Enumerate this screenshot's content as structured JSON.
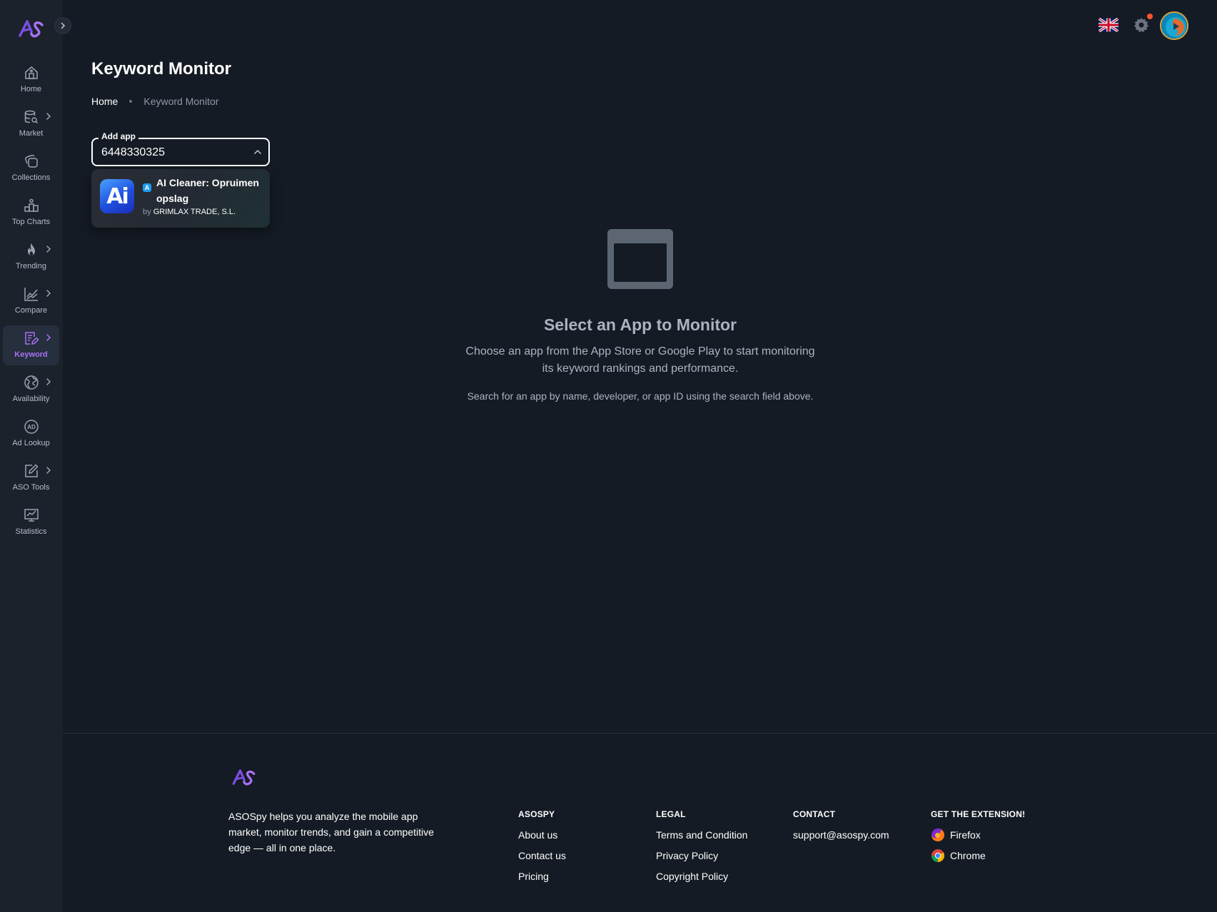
{
  "sidebar": {
    "items": [
      {
        "label": "Home",
        "icon": "home-icon",
        "has_submenu": false,
        "active": false
      },
      {
        "label": "Market",
        "icon": "database-search-icon",
        "has_submenu": true,
        "active": false
      },
      {
        "label": "Collections",
        "icon": "collections-icon",
        "has_submenu": false,
        "active": false
      },
      {
        "label": "Top Charts",
        "icon": "podium-icon",
        "has_submenu": false,
        "active": false
      },
      {
        "label": "Trending",
        "icon": "flame-icon",
        "has_submenu": true,
        "active": false
      },
      {
        "label": "Compare",
        "icon": "line-chart-icon",
        "has_submenu": true,
        "active": false
      },
      {
        "label": "Keyword",
        "icon": "keyword-edit-icon",
        "has_submenu": true,
        "active": true
      },
      {
        "label": "Availability",
        "icon": "globe-icon",
        "has_submenu": true,
        "active": false
      },
      {
        "label": "Ad Lookup",
        "icon": "ad-icon",
        "has_submenu": false,
        "active": false
      },
      {
        "label": "ASO Tools",
        "icon": "edit-square-icon",
        "has_submenu": true,
        "active": false
      },
      {
        "label": "Statistics",
        "icon": "statistics-monitor-icon",
        "has_submenu": false,
        "active": false
      }
    ]
  },
  "header": {
    "title": "Keyword Monitor",
    "breadcrumb": {
      "home": "Home",
      "current": "Keyword Monitor"
    }
  },
  "add_app": {
    "label": "Add app",
    "value": "6448330325"
  },
  "dropdown": {
    "results": [
      {
        "name": "AI Cleaner: Opruimen opslag",
        "by": "by",
        "developer": "GRIMLAX TRADE, S.L.",
        "icon_text": "Ai",
        "store": "App Store"
      }
    ]
  },
  "empty_state": {
    "title": "Select an App to Monitor",
    "description": "Choose an app from the App Store or Google Play to start monitoring its keyword rankings and performance.",
    "hint": "Search for an app by name, developer, or app ID using the search field above."
  },
  "footer": {
    "about": "ASOSpy helps you analyze the mobile app market, monitor trends, and gain a competitive edge — all in one place.",
    "columns": {
      "asospy": {
        "title": "ASOSPY",
        "links": [
          "About us",
          "Contact us",
          "Pricing"
        ]
      },
      "legal": {
        "title": "LEGAL",
        "links": [
          "Terms and Condition",
          "Privacy Policy",
          "Copyright Policy"
        ]
      },
      "contact": {
        "title": "CONTACT",
        "links": [
          "support@asospy.com"
        ]
      },
      "extension": {
        "title": "GET THE EXTENSION!",
        "links": [
          "Firefox",
          "Chrome"
        ]
      }
    }
  },
  "colors": {
    "background": "#151b24",
    "sidebar": "#1b222c",
    "accent": "#a971f4",
    "notification": "#ff5630"
  }
}
